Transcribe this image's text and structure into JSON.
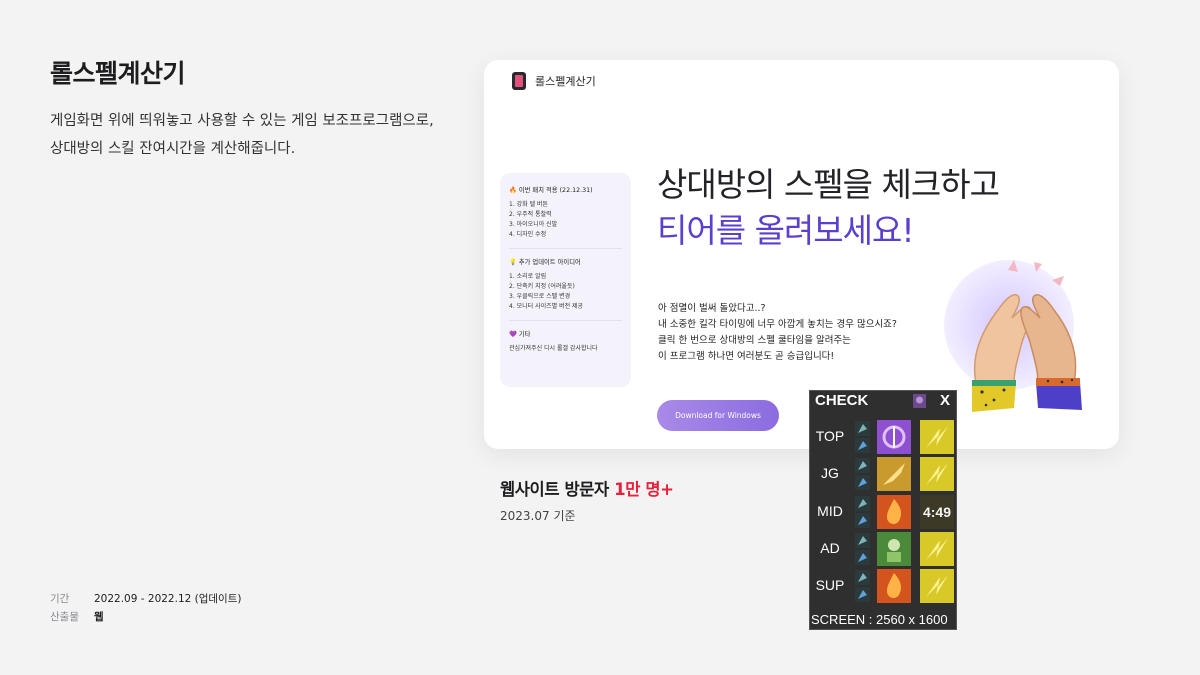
{
  "project": {
    "title": "롤스펠계산기",
    "description_lines": [
      "게임화면 위에 띄워놓고 사용할 수 있는 게임 보조프로그램으로,",
      "상대방의 스킬 잔여시간을 계산해줍니다."
    ],
    "meta": [
      {
        "key": "기간",
        "value": "2022.09 - 2022.12 (업데이트)"
      },
      {
        "key": "산출물",
        "value": "웹"
      }
    ]
  },
  "mockup": {
    "logo_text": "롤스펠계산기",
    "patch_card": {
      "sections": [
        {
          "title": "🔥 이번 패치 적용 (22.12.31)",
          "items": [
            "1. 강화 텔 버튼",
            "2. 우주적 통찰력",
            "3. 아이오니아 신발",
            "4. 디자인 수정"
          ]
        },
        {
          "title": "💡 추가 업데이트 아이디어",
          "items": [
            "1. 소리로 알림",
            "2. 단축키 지정 (어려울듯)",
            "3. 우클릭으로 스펠 변경",
            "4. 모니터 사이즈별 버전 제공"
          ]
        },
        {
          "title": "💜 기타",
          "items": [
            "관심가져주신 디시 롤갤 감사합니다"
          ]
        }
      ]
    },
    "headline_line1": "상대방의 스펠을 체크하고",
    "headline_line2": "티어를 올려보세요!",
    "body_lines": [
      "아 점멸이 벌써 돌았다고..?",
      "내 소중한 킬각 타이밍에 너무 아깝게 놓치는 경우 많으시죠?",
      "클릭 한 번으로 상대방의 스펠 쿨타임을 알려주는",
      "이 프로그램 하나면 여러분도 곧 승급입니다!"
    ],
    "download_label": "Download for Windows"
  },
  "stats": {
    "prefix": "웹사이트 방문자 ",
    "highlight": "1만 명+",
    "date": "2023.07 기준"
  },
  "overlay": {
    "header": "CHECK",
    "close": "X",
    "rows": [
      {
        "lane": "TOP",
        "spell1": "teleport",
        "spell2": "flash",
        "timer": ""
      },
      {
        "lane": "JG",
        "spell1": "smite",
        "spell2": "flash",
        "timer": ""
      },
      {
        "lane": "MID",
        "spell1": "ignite",
        "spell2": "flash",
        "timer": "4:49"
      },
      {
        "lane": "AD",
        "spell1": "heal",
        "spell2": "flash",
        "timer": ""
      },
      {
        "lane": "SUP",
        "spell1": "ignite",
        "spell2": "flash",
        "timer": ""
      }
    ],
    "screen_label": "SCREEN : 2560 x 1600",
    "colors": {
      "teleport": "#8e4fd1",
      "flash": "#d8c828",
      "smite": "#c99a2e",
      "ignite": "#d4541e",
      "heal": "#4a8a3a"
    }
  }
}
